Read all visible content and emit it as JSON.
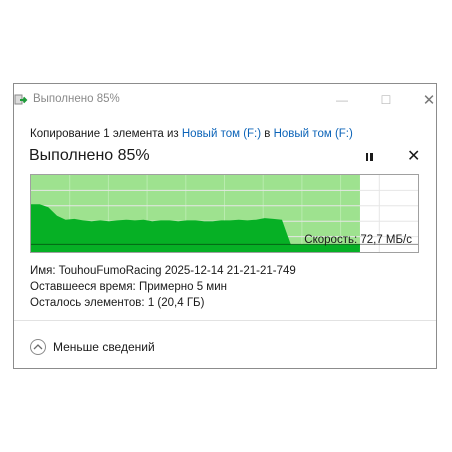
{
  "window": {
    "title": "Выполнено 85%",
    "controls": {
      "minimize": "—",
      "maximize": "☐",
      "close": "✕"
    }
  },
  "copy": {
    "prefix": "Копирование 1 элемента из",
    "source": "Новый том (F:)",
    "connector": "в",
    "destination": "Новый том (F:)"
  },
  "status": {
    "heading": "Выполнено 85%",
    "progress_percent": 85,
    "speed_label": "Скорость: 72,7 МБ/с"
  },
  "graph": {
    "fill_color": "#06b025",
    "done_area_color": "#9ee28f",
    "speed_trace": [
      0.62,
      0.62,
      0.58,
      0.47,
      0.42,
      0.43,
      0.41,
      0.4,
      0.41,
      0.4,
      0.41,
      0.42,
      0.41,
      0.42,
      0.4,
      0.41,
      0.41,
      0.4,
      0.41,
      0.41,
      0.4,
      0.4,
      0.41,
      0.41,
      0.42,
      0.41,
      0.42,
      0.44,
      0.43,
      0.42,
      0.1,
      0.1,
      0.1,
      0.1,
      0.1,
      0.1,
      0.1,
      0.1,
      0.1
    ]
  },
  "details": {
    "name_label": "Имя:",
    "name_value": "TouhouFumoRacing 2025-12-14 21-21-21-749",
    "time_label": "Оставшееся время:",
    "time_value": "Примерно 5 мин",
    "items_label": "Осталось элементов:",
    "items_value": "1 (20,4 ГБ)"
  },
  "toggle": {
    "label": "Меньше сведений"
  }
}
